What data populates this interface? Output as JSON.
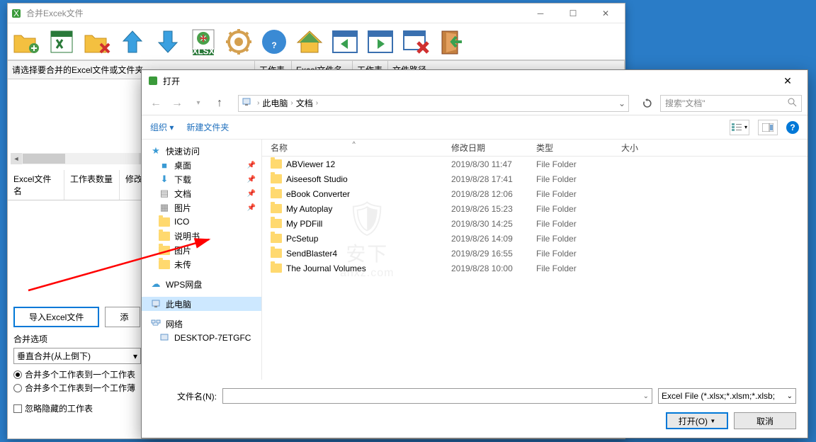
{
  "parent": {
    "title": "合并Excek文件",
    "header_left": "请选择要合并的Excel文件或文件夹",
    "headers2": [
      "工作表",
      "Excel文件名",
      "工作表",
      "文件路径"
    ],
    "excel_headers": [
      "Excel文件名",
      "工作表数量",
      "修改"
    ],
    "btn_import": "导入Excel文件",
    "btn_add": "添",
    "merge_options": "合并选项",
    "merge_direction": "垂直合并(从上倒下)",
    "radio1": "合井多个工作表到一个工作表",
    "radio2": "合并多个工作表到一个工作薄",
    "checkbox1": "忽略隐藏的工作表"
  },
  "dialog": {
    "title": "打开",
    "breadcrumb": {
      "part1": "此电脑",
      "part2": "文档"
    },
    "search_placeholder": "搜索\"文档\"",
    "toolbar": {
      "organize": "组织",
      "newfolder": "新建文件夹"
    },
    "sidebar": {
      "quick_access": "快速访问",
      "desktop": "桌面",
      "downloads": "下载",
      "documents": "文档",
      "pictures": "图片",
      "ico": "ICO",
      "manual": "说明书",
      "pictures2": "图片",
      "unsent": "未传",
      "wps": "WPS网盘",
      "thispc": "此电脑",
      "network": "网络",
      "desktop_pc": "DESKTOP-7ETGFC"
    },
    "columns": {
      "name": "名称",
      "date": "修改日期",
      "type": "类型",
      "size": "大小"
    },
    "files": [
      {
        "name": "ABViewer 12",
        "date": "2019/8/30 11:47",
        "type": "File Folder"
      },
      {
        "name": "Aiseesoft Studio",
        "date": "2019/8/28 17:41",
        "type": "File Folder"
      },
      {
        "name": "eBook Converter",
        "date": "2019/8/28 12:06",
        "type": "File Folder"
      },
      {
        "name": "My Autoplay",
        "date": "2019/8/26 15:23",
        "type": "File Folder"
      },
      {
        "name": "My PDFill",
        "date": "2019/8/30 14:25",
        "type": "File Folder"
      },
      {
        "name": "PcSetup",
        "date": "2019/8/26 14:09",
        "type": "File Folder"
      },
      {
        "name": "SendBlaster4",
        "date": "2019/8/29 16:55",
        "type": "File Folder"
      },
      {
        "name": "The Journal Volumes",
        "date": "2019/8/28 10:00",
        "type": "File Folder"
      }
    ],
    "filename_label": "文件名(N):",
    "filetype": "Excel File (*.xlsx;*.xlsm;*.xlsb;",
    "btn_open": "打开(O)",
    "btn_cancel": "取消"
  },
  "watermark": {
    "text": "安下",
    "url": "anxz.com"
  }
}
